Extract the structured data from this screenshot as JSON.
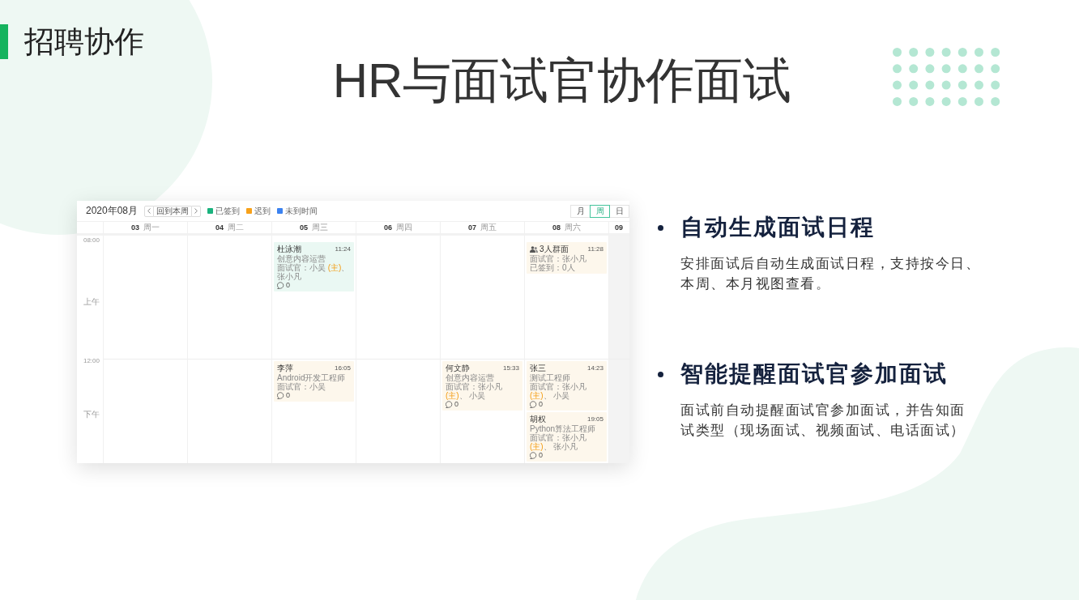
{
  "section_title": "招聘协作",
  "headline": "HR与面试官协作面试",
  "calendar": {
    "month": "2020年08月",
    "today_button": "回到本周",
    "legend": [
      {
        "label": "已签到",
        "color": "#1ab37e"
      },
      {
        "label": "迟到",
        "color": "#f7a11a"
      },
      {
        "label": "未到时间",
        "color": "#3b82f0"
      }
    ],
    "views": [
      {
        "label": "月",
        "selected": false
      },
      {
        "label": "周",
        "selected": true
      },
      {
        "label": "日",
        "selected": false
      }
    ],
    "time_labels": {
      "morning": {
        "time": "08:00",
        "period": "上午"
      },
      "afternoon": {
        "time": "12:00",
        "period": "下午"
      }
    },
    "days": [
      {
        "date": "03",
        "weekday": "周一",
        "dimmed": false
      },
      {
        "date": "04",
        "weekday": "周二",
        "dimmed": false
      },
      {
        "date": "05",
        "weekday": "周三",
        "dimmed": false,
        "morning": [
          {
            "kind": "interview",
            "color": "#eaf8f3",
            "title": "杜泳潮",
            "time": "11:24",
            "lines": [
              {
                "segments": [
                  {
                    "kind": "plain",
                    "text": "创意内容运营"
                  }
                ]
              },
              {
                "segments": [
                  {
                    "kind": "plain",
                    "text": "面试官：小吴 "
                  },
                  {
                    "kind": "lead",
                    "text": "(主)"
                  },
                  {
                    "kind": "plain",
                    "text": "、张小凡"
                  }
                ]
              }
            ],
            "comments": "0"
          }
        ],
        "afternoon": [
          {
            "kind": "interview",
            "color": "#fdf7ec",
            "title": "李萍",
            "time": "16:05",
            "lines": [
              {
                "segments": [
                  {
                    "kind": "plain",
                    "text": "Android开发工程师"
                  }
                ]
              },
              {
                "segments": [
                  {
                    "kind": "plain",
                    "text": "面试官：小吴"
                  }
                ]
              }
            ],
            "comments": "0"
          }
        ]
      },
      {
        "date": "06",
        "weekday": "周四",
        "dimmed": false
      },
      {
        "date": "07",
        "weekday": "周五",
        "dimmed": false,
        "afternoon": [
          {
            "kind": "interview",
            "color": "#fdf7ec",
            "title": "何文静",
            "time": "15:33",
            "lines": [
              {
                "segments": [
                  {
                    "kind": "plain",
                    "text": "创意内容运营"
                  }
                ]
              },
              {
                "segments": [
                  {
                    "kind": "plain",
                    "text": "面试官：张小凡 "
                  },
                  {
                    "kind": "lead",
                    "text": "(主)"
                  },
                  {
                    "kind": "plain",
                    "text": "、 小吴"
                  }
                ]
              }
            ],
            "comments": "0"
          }
        ]
      },
      {
        "date": "08",
        "weekday": "周六",
        "dimmed": false,
        "morning": [
          {
            "kind": "group",
            "color": "#fdf7ec",
            "title": "3人群面",
            "time": "11:28",
            "lines": [
              {
                "segments": [
                  {
                    "kind": "plain",
                    "text": "面试官：张小凡"
                  }
                ]
              },
              {
                "segments": [
                  {
                    "kind": "plain",
                    "text": "已签到：0人"
                  }
                ]
              }
            ]
          }
        ],
        "afternoon": [
          {
            "kind": "interview",
            "color": "#fdf7ec",
            "title": "张三",
            "time": "14:23",
            "lines": [
              {
                "segments": [
                  {
                    "kind": "plain",
                    "text": "测试工程师"
                  }
                ]
              },
              {
                "segments": [
                  {
                    "kind": "plain",
                    "text": "面试官：张小凡 "
                  },
                  {
                    "kind": "lead",
                    "text": "(主)"
                  },
                  {
                    "kind": "plain",
                    "text": "、 小吴"
                  }
                ]
              }
            ],
            "comments": "0"
          },
          {
            "kind": "interview",
            "color": "#fdf7ec",
            "title": "胡权",
            "time": "19:05",
            "lines": [
              {
                "segments": [
                  {
                    "kind": "plain",
                    "text": "Python算法工程师"
                  }
                ]
              },
              {
                "segments": [
                  {
                    "kind": "plain",
                    "text": "面试官：张小凡 "
                  },
                  {
                    "kind": "lead",
                    "text": "(主)"
                  },
                  {
                    "kind": "plain",
                    "text": "、 张小凡"
                  }
                ]
              }
            ],
            "comments": "0"
          }
        ]
      },
      {
        "date": "09",
        "dimmed": true
      }
    ]
  },
  "features": [
    {
      "title": "自动生成面试日程",
      "description_lines": [
        "安排面试后自动生成面试日程，支持按今日、",
        "本周、本月视图查看。"
      ]
    },
    {
      "title": "智能提醒面试官参加面试",
      "description_lines": [
        "面试前自动提醒面试官参加面试，并告知面",
        "试类型（现场面试、视频面试、电话面试）"
      ]
    }
  ]
}
